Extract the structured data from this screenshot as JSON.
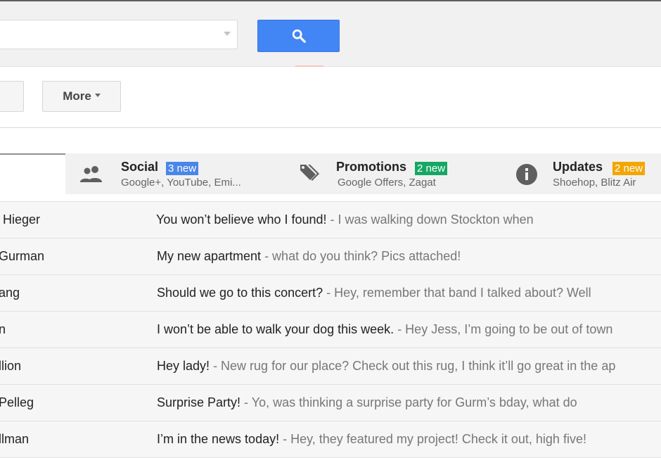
{
  "search": {
    "value": "",
    "caret_icon": "caret-down",
    "button_icon": "search-icon",
    "button_color": "#4285f4"
  },
  "toolbar": {
    "more_label": "More"
  },
  "tabs": [
    {
      "id": "social",
      "icon": "people-icon",
      "title": "Social",
      "badge": "3 new",
      "badge_color": "#4a86e8",
      "subtitle": "Google+, YouTube, Emi..."
    },
    {
      "id": "promotions",
      "icon": "tag-icon",
      "title": "Promotions",
      "badge": "2 new",
      "badge_color": "#16a765",
      "subtitle": "Google Offers, Zagat"
    },
    {
      "id": "updates",
      "icon": "info-icon",
      "title": "Updates",
      "badge": "2 new",
      "badge_color": "#f2a600",
      "subtitle": "Shoehop, Blitz Air"
    }
  ],
  "emails": [
    {
      "sender": "Hieger",
      "subject": "You won’t believe who I found!",
      "snippet": " - I was walking down Stockton when"
    },
    {
      "sender": "Gurman",
      "subject": "My new apartment",
      "snippet": " - what do you think? Pics attached!"
    },
    {
      "sender": "ang",
      "subject": "Should we go to this concert?",
      "snippet": " - Hey, remember that band I talked about? Well"
    },
    {
      "sender": "n",
      "subject": "I won’t be able to walk your dog this week.",
      "snippet": " - Hey Jess, I’m going to be out of town"
    },
    {
      "sender": "llion",
      "subject": "Hey lady!",
      "snippet": " - New rug for our place? Check out this rug, I think it’ll go great in the ap"
    },
    {
      "sender": "Pelleg",
      "subject": "Surprise Party!",
      "snippet": " - Yo, was thinking a surprise party for Gurm’s bday, what do"
    },
    {
      "sender": "llman",
      "subject": "I’m in the news today!",
      "snippet": " - Hey, they featured my project! Check it out, high five!"
    }
  ]
}
